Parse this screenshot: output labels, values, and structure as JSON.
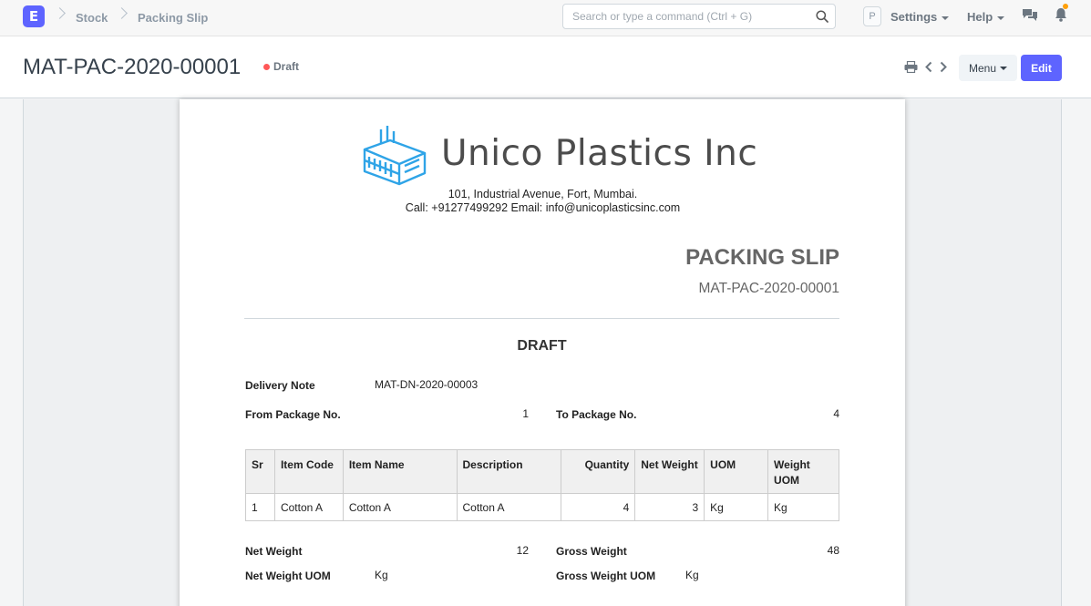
{
  "navbar": {
    "logo_letter": "E",
    "breadcrumbs": [
      "Stock",
      "Packing Slip"
    ],
    "search_placeholder": "Search or type a command (Ctrl + G)",
    "avatar_letter": "P",
    "settings_label": "Settings",
    "help_label": "Help"
  },
  "page": {
    "title": "MAT-PAC-2020-00001",
    "status": "Draft",
    "menu_label": "Menu",
    "edit_label": "Edit"
  },
  "doc": {
    "company_name": "Unico Plastics Inc",
    "address": "101, Industrial Avenue, Fort, Mumbai.",
    "contact": "Call: +91277499292 Email: info@unicoplasticsinc.com",
    "doc_type": "PACKING SLIP",
    "doc_name": "MAT-PAC-2020-00001",
    "draft_label": "DRAFT",
    "delivery_note_label": "Delivery Note",
    "delivery_note": "MAT-DN-2020-00003",
    "from_package_label": "From Package No.",
    "from_package": "1",
    "to_package_label": "To Package No.",
    "to_package": "4",
    "columns": [
      "Sr",
      "Item Code",
      "Item Name",
      "Description",
      "Quantity",
      "Net Weight",
      "UOM",
      "Weight UOM"
    ],
    "rows": [
      {
        "sr": "1",
        "item_code": "Cotton A",
        "item_name": "Cotton A",
        "description": "Cotton A",
        "qty": "4",
        "net_weight": "3",
        "uom": "Kg",
        "weight_uom": "Kg"
      }
    ],
    "net_weight_label": "Net Weight",
    "net_weight": "12",
    "gross_weight_label": "Gross Weight",
    "gross_weight": "48",
    "net_weight_uom_label": "Net Weight UOM",
    "net_weight_uom": "Kg",
    "gross_weight_uom_label": "Gross Weight UOM",
    "gross_weight_uom": "Kg"
  },
  "colors": {
    "accent": "#5e64ff",
    "status_draft": "#ff5858",
    "logo_blue": "#2fa4e7",
    "notification": "#ffa00a"
  }
}
